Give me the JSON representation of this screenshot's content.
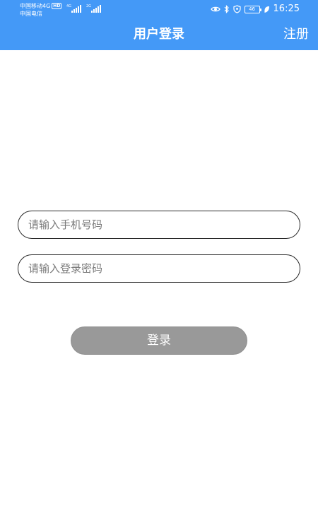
{
  "status_bar": {
    "carrier_1": "中国移动4G",
    "carrier_1_badge": "HD",
    "carrier_2": "中国电信",
    "signal_1_tag": "4G",
    "signal_2_tag": "2G",
    "battery_level": "46",
    "time": "16:25",
    "icons": [
      "eye-icon",
      "bluetooth-icon",
      "location-icon",
      "battery-icon",
      "leaf-icon"
    ]
  },
  "header": {
    "title": "用户登录",
    "register_label": "注册",
    "background_color": "#4499f7"
  },
  "form": {
    "phone_placeholder": "请输入手机号码",
    "phone_value": "",
    "password_placeholder": "请输入登录密码",
    "password_value": "",
    "login_label": "登录",
    "login_button_color": "#999999"
  }
}
